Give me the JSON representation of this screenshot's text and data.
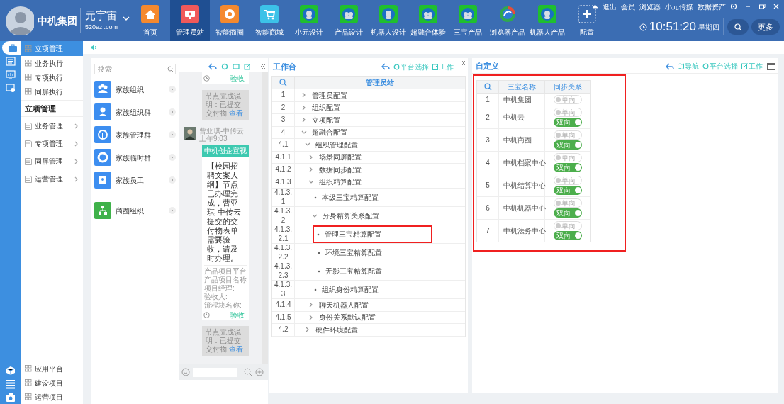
{
  "brand": {
    "name": "中机集团",
    "product": "元宇宙",
    "domain": "520ezj.com"
  },
  "nav": [
    {
      "label": "首页",
      "kind": "home",
      "selected": false
    },
    {
      "label": "管理员站",
      "kind": "monitor",
      "selected": true
    },
    {
      "label": "智能商圈",
      "kind": "aperture",
      "selected": false
    },
    {
      "label": "智能商城",
      "kind": "cart",
      "selected": false
    },
    {
      "label": "小元设计",
      "kind": "robot",
      "selected": false
    },
    {
      "label": "产品设计",
      "kind": "robots",
      "selected": false
    },
    {
      "label": "机器人设计",
      "kind": "robot",
      "selected": false
    },
    {
      "label": "超融合体验",
      "kind": "robots",
      "selected": false
    },
    {
      "label": "三宝产品",
      "kind": "robots",
      "selected": false
    },
    {
      "label": "浏览器产品",
      "kind": "browser",
      "selected": false
    },
    {
      "label": "机器人产品",
      "kind": "robot",
      "selected": false
    },
    {
      "label": "配置",
      "kind": "add",
      "selected": false
    }
  ],
  "top_links": [
    "退出",
    "会员",
    "浏览器",
    "小元传媒",
    "数据资产"
  ],
  "clock": {
    "time": "10:51:20",
    "weekday": "星期四"
  },
  "more_button": "更多",
  "rail_top": [
    {
      "kind": "briefcase",
      "selected": true
    },
    {
      "kind": "document",
      "selected": false
    },
    {
      "kind": "chart",
      "selected": false
    },
    {
      "kind": "screen",
      "selected": false
    }
  ],
  "rail_bottom": [
    {
      "kind": "box",
      "selected": false
    },
    {
      "kind": "list",
      "selected": false
    },
    {
      "kind": "camera",
      "selected": false
    }
  ],
  "sidebar": {
    "items": [
      {
        "label": "立项管理",
        "selected": true
      },
      {
        "label": "业务执行",
        "selected": false
      },
      {
        "label": "专项执行",
        "selected": false
      },
      {
        "label": "同屏执行",
        "selected": false
      }
    ],
    "section_title": "立项管理",
    "groups": [
      "业务管理",
      "专项管理",
      "同屏管理",
      "运营管理"
    ],
    "bottom_items": [
      "应用平台",
      "建设项目",
      "运营项目"
    ]
  },
  "contacts": {
    "placeholder": "搜索",
    "sections": [
      [
        {
          "label": "家族组织",
          "kind": "group",
          "color": "#3d8ef0",
          "expanded": true
        },
        {
          "label": "家族组织群",
          "kind": "person",
          "color": "#3d8ef0",
          "expanded": false
        },
        {
          "label": "家族管理群",
          "kind": "pin",
          "color": "#3d8ef0",
          "expanded": false
        },
        {
          "label": "家族临时群",
          "kind": "ring",
          "color": "#3d8ef0",
          "expanded": false
        },
        {
          "label": "家族员工",
          "kind": "badge",
          "color": "#3d8ef0",
          "expanded": false
        }
      ],
      [
        {
          "label": "商圈组织",
          "kind": "tree",
          "color": "#3fb24a",
          "expanded": false
        }
      ]
    ]
  },
  "chat": {
    "messages": [
      {
        "kind": "card_tail",
        "action": "验收"
      },
      {
        "kind": "notice",
        "text": "节点完成说明：已提交交付物",
        "link": "查看"
      },
      {
        "kind": "message",
        "sender": "曹亚琪-中传云",
        "time": "上午9:03",
        "header": "中机创企宣视",
        "body": "【校园招聘文案大纲】节点已办理完成，曹亚琪-中传云提交的交付物表单需要验收，请及时办理。",
        "details": [
          "产品项目平台",
          "产品项目名称",
          "项目经理:",
          "验收人:",
          "流程块名称:"
        ],
        "action": "验收"
      },
      {
        "kind": "notice",
        "text": "节点完成说明：已提交交付物",
        "link": "查看"
      }
    ]
  },
  "workbench": {
    "title": "工作台",
    "tools": [
      "平台选择",
      "工作"
    ],
    "column_title": "管理员站",
    "tree": [
      {
        "index": "1",
        "label": "管理员配置",
        "expanded": false,
        "highlighted": false
      },
      {
        "index": "2",
        "label": "组织配置",
        "expanded": false,
        "highlighted": false
      },
      {
        "index": "3",
        "label": "立项配置",
        "expanded": false,
        "highlighted": false
      },
      {
        "index": "4",
        "label": "超融合配置",
        "expanded": true,
        "highlighted": false,
        "children": [
          {
            "index": "4.1",
            "label": "组织管理配置",
            "expanded": true,
            "highlighted": false,
            "children": [
              {
                "index": "4.1.1",
                "label": "场景同屏配置",
                "expanded": false,
                "highlighted": false
              },
              {
                "index": "4.1.2",
                "label": "数据同步配置",
                "expanded": false,
                "highlighted": false
              },
              {
                "index": "4.1.3",
                "label": "组织精算配置",
                "expanded": true,
                "highlighted": false,
                "children": [
                  {
                    "index": "4.1.3.1",
                    "label": "本级三宝精算配置",
                    "highlighted": false
                  },
                  {
                    "index": "4.1.3.2",
                    "label": "分身精算关系配置",
                    "expanded": true,
                    "highlighted": false,
                    "children": [
                      {
                        "index": "4.1.3.2.1",
                        "label": "管理三宝精算配置",
                        "highlighted": true
                      },
                      {
                        "index": "4.1.3.2.2",
                        "label": "环境三宝精算配置",
                        "highlighted": false
                      },
                      {
                        "index": "4.1.3.2.3",
                        "label": "无影三宝精算配置",
                        "highlighted": false
                      }
                    ]
                  },
                  {
                    "index": "4.1.3.3",
                    "label": "组织身份精算配置",
                    "highlighted": false
                  }
                ]
              },
              {
                "index": "4.1.4",
                "label": "聊天机器人配置",
                "expanded": false,
                "highlighted": false
              },
              {
                "index": "4.1.5",
                "label": "身份关系默认配置",
                "expanded": false,
                "highlighted": false
              }
            ]
          },
          {
            "index": "4.2",
            "label": "硬件环境配置",
            "expanded": false,
            "highlighted": false
          }
        ]
      }
    ]
  },
  "custom": {
    "title": "自定义",
    "tools": [
      "导航",
      "平台选择",
      "工作"
    ],
    "highlighted": true,
    "columns": [
      "三宝名称",
      "同步关系"
    ],
    "rows": [
      {
        "index": "1",
        "name": "中机集团",
        "sync": [
          {
            "label": "单向",
            "on": false
          }
        ]
      },
      {
        "index": "2",
        "name": "中机云",
        "sync": [
          {
            "label": "单向",
            "on": false
          },
          {
            "label": "双向",
            "on": true
          }
        ]
      },
      {
        "index": "3",
        "name": "中机商圈",
        "sync": [
          {
            "label": "单向",
            "on": false
          },
          {
            "label": "双向",
            "on": true
          }
        ]
      },
      {
        "index": "4",
        "name": "中机档案中心",
        "sync": [
          {
            "label": "单向",
            "on": false
          },
          {
            "label": "双向",
            "on": true
          }
        ]
      },
      {
        "index": "5",
        "name": "中机结算中心",
        "sync": [
          {
            "label": "单向",
            "on": false
          },
          {
            "label": "双向",
            "on": true
          }
        ]
      },
      {
        "index": "6",
        "name": "中机机器中心",
        "sync": [
          {
            "label": "单向",
            "on": false
          },
          {
            "label": "双向",
            "on": true
          }
        ]
      },
      {
        "index": "7",
        "name": "中机法务中心",
        "sync": [
          {
            "label": "单向",
            "on": false
          },
          {
            "label": "双向",
            "on": true
          }
        ]
      }
    ]
  }
}
